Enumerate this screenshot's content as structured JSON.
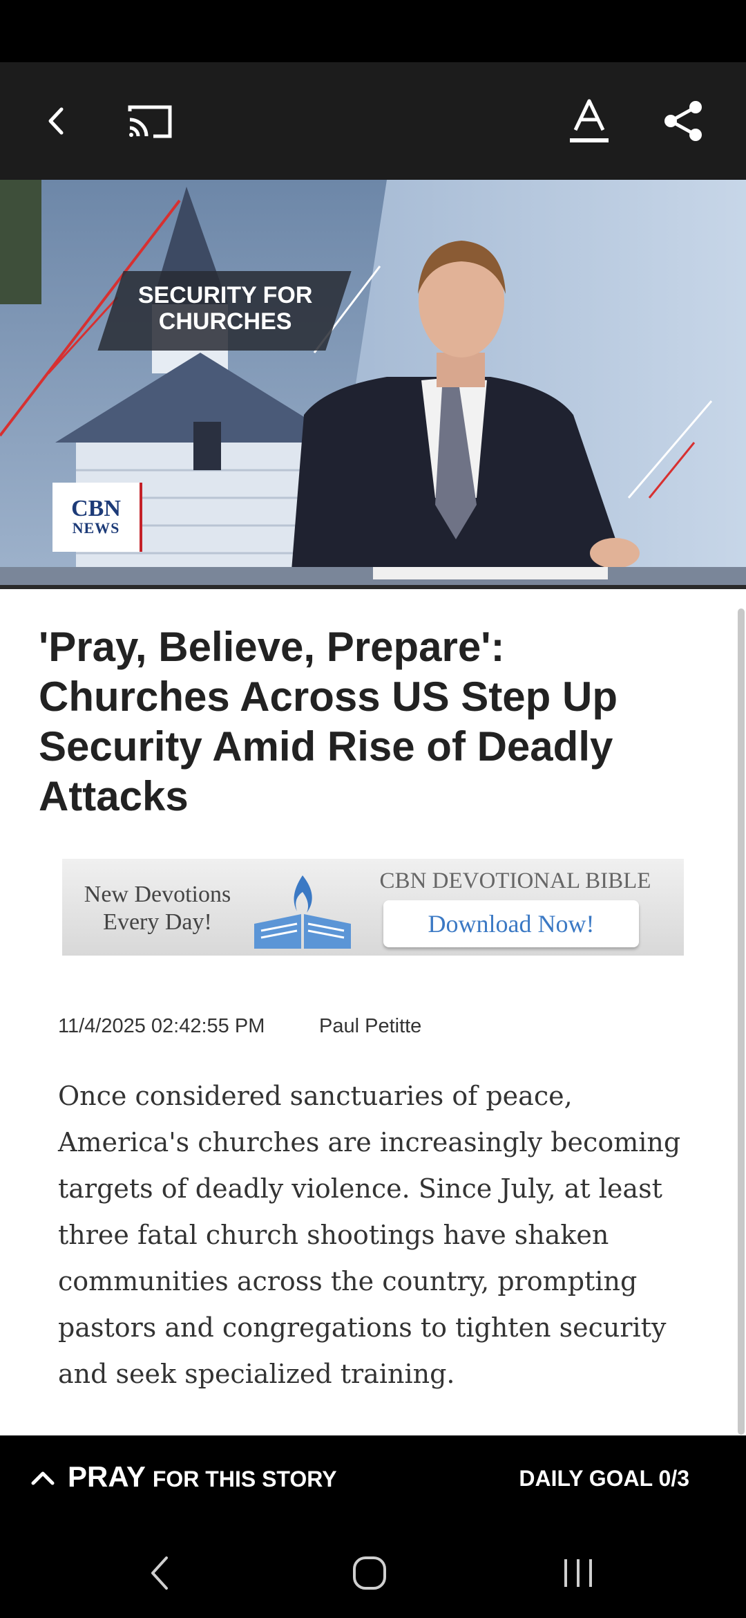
{
  "article": {
    "hero_overlay": "SECURITY FOR\nCHURCHES",
    "logo_line1": "CBN",
    "logo_line2": "NEWS",
    "headline": "'Pray, Believe, Prepare': Churches Across US Step Up Security Amid Rise of Deadly Attacks",
    "date": "11/4/2025 02:42:55 PM",
    "author": "Paul Petitte",
    "body": "Once considered sanctuaries of peace, America's churches are increasingly becoming targets of deadly violence. Since July, at least three fatal church shootings have shaken communities across the country, prompting pastors and congregations to tighten security and seek specialized training."
  },
  "ad": {
    "left_line1": "New Devotions",
    "left_line2": "Every Day!",
    "title": "CBN DEVOTIONAL BIBLE",
    "button": "Download Now!"
  },
  "pray_bar": {
    "pray": "PRAY",
    "rest": "FOR THIS STORY",
    "goal": "DAILY GOAL 0/3"
  },
  "icons": {
    "back": "chevron-left-icon",
    "cast": "cast-icon",
    "text_size": "text-size-icon",
    "share": "share-icon",
    "expand": "chevron-up-icon"
  }
}
